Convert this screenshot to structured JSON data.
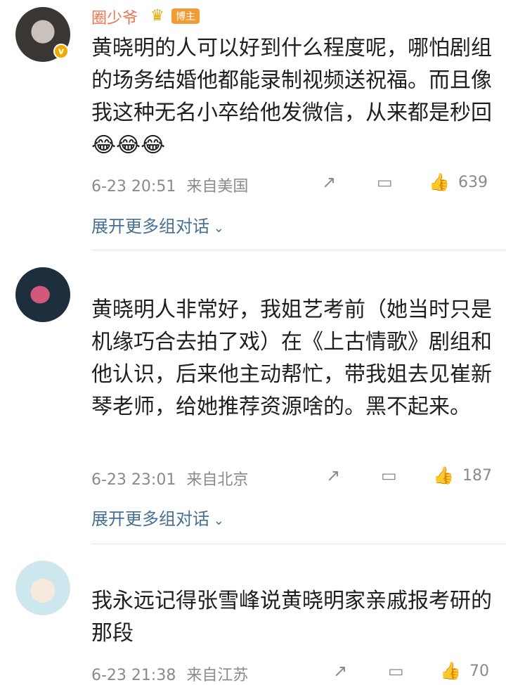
{
  "comments": [
    {
      "username": "圈少爷",
      "tag": "博主",
      "text": "黄晓明的人可以好到什么程度呢，哪怕剧组的场务结婚他都能录制视频送祝福。而且像我这种无名小卒给他发微信，从来都是秒回😂😂😂",
      "time": "6-23 20:51",
      "location": "来自美国",
      "likes": "639",
      "expand": "展开更多组对话"
    },
    {
      "text": "黄晓明人非常好，我姐艺考前（她当时只是机缘巧合去拍了戏）在《上古情歌》剧组和他认识，后来他主动帮忙，带我姐去见崔新琴老师，给她推荐资源啥的。黑不起来。",
      "time": "6-23 23:01",
      "location": "来自北京",
      "likes": "187",
      "expand": "展开更多组对话"
    },
    {
      "text": "我永远记得张雪峰说黄晓明家亲戚报考研的那段",
      "time": "6-23 21:38",
      "location": "来自江苏",
      "likes": "70"
    }
  ],
  "icons": {
    "share": "share-icon",
    "reply": "comment-icon",
    "like": "thumbs-up-icon",
    "expand": "chevron-down-icon"
  },
  "colors": {
    "username": "#eb7350",
    "link": "#466f95",
    "meta": "#8a8a8a"
  }
}
